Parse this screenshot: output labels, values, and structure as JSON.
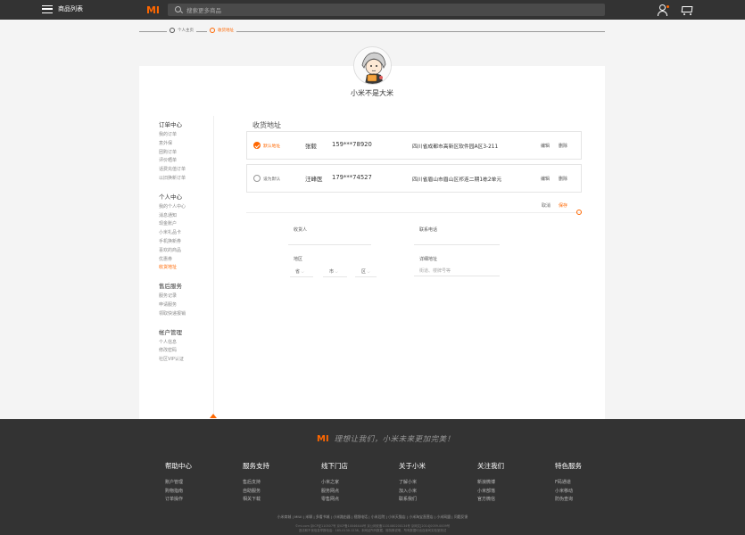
{
  "header": {
    "menu_label": "商品列表",
    "logo_text": "MI",
    "search_placeholder": "搜索更多商品",
    "accent_color": "#ff6700"
  },
  "steps": [
    {
      "label": "个人主页",
      "active": false
    },
    {
      "label": "收货地址",
      "active": true
    }
  ],
  "profile": {
    "username": "小米不是大米",
    "avatar_icon": "anime-character-avatar"
  },
  "sidebar": {
    "groups": [
      {
        "title": "订单中心",
        "items": [
          "我的订单",
          "意外保",
          "团购订单",
          "评价晒单",
          "话费充值订单",
          "以旧换新订单"
        ]
      },
      {
        "title": "个人中心",
        "items": [
          "我的个人中心",
          "消息通知",
          "现金账户",
          "小米礼品卡",
          "手机换新券",
          "喜欢的商品",
          "优惠券",
          "收货地址"
        ],
        "active_index": 7
      },
      {
        "title": "售后服务",
        "items": [
          "服务记录",
          "申请服务",
          "领取快递报销"
        ]
      },
      {
        "title": "帐户管理",
        "items": [
          "个人信息",
          "修改密码",
          "社区VIP认证"
        ]
      }
    ]
  },
  "section_title": "收货地址",
  "addresses": [
    {
      "tag": "默认地址",
      "is_default": true,
      "name": "张毅",
      "phone": "159***78920",
      "address": "四川省成都市高新区软件园A区3-211",
      "edit": "编辑",
      "delete": "删除"
    },
    {
      "tag": "设为默认",
      "is_default": false,
      "name": "汪峰医",
      "phone": "179***74527",
      "address": "四川省眉山市眉山区祁连二期1栋2单元",
      "edit": "编辑",
      "delete": "删除"
    }
  ],
  "form": {
    "cancel": "取消",
    "save": "保存",
    "receiver_label": "收货人",
    "phone_label": "联系电话",
    "region_label": "地区",
    "detail_label": "详细地址",
    "province": "省",
    "city": "市",
    "district": "区",
    "detail_placeholder": "街道、楼牌号等"
  },
  "footer": {
    "slogan": "理想让我们，小米未来更加完美！",
    "columns": [
      {
        "title": "帮助中心",
        "items": [
          "账户管理",
          "购物指南",
          "订单操作"
        ]
      },
      {
        "title": "服务支持",
        "items": [
          "售后支持",
          "自助服务",
          "相关下载"
        ]
      },
      {
        "title": "线下门店",
        "items": [
          "小米之家",
          "服务网点",
          "零售网点"
        ]
      },
      {
        "title": "关于小米",
        "items": [
          "了解小米",
          "加入小米",
          "联系我们"
        ]
      },
      {
        "title": "关注我们",
        "items": [
          "新浪微博",
          "小米部落",
          "官方微信"
        ]
      },
      {
        "title": "特色服务",
        "items": [
          "F码通道",
          "小米移动",
          "防伪查询"
        ]
      }
    ],
    "links": "小米商城 | MIUI | 米聊 | 多看书城 | 小米路由器 | 视频电话 | 小米后院 | 小米天猫店 | 小米淘宝直营店 | 小米网盟 | 问题反馈",
    "legal1": "©mi.com 京ICP证110507号 京ICP备10046444号 京公网安备1101080200134号 京网文[2014]0059-0009号",
    "legal2": "违法和不良信息举报电话：185-0130-1238，本网站所列数据，除特殊说明，所有数据均出自我司实验室测试"
  }
}
